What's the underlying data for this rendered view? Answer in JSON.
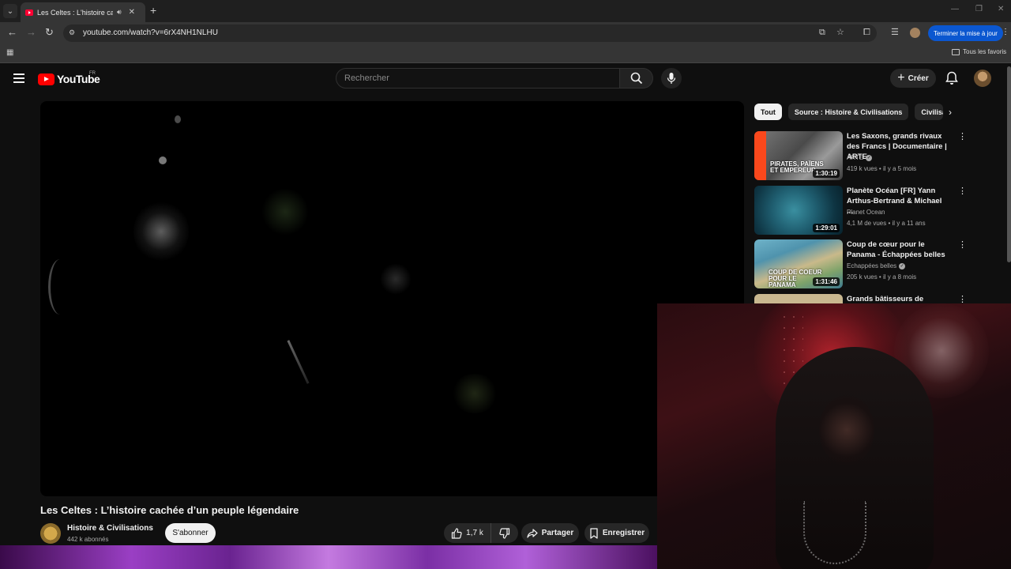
{
  "browser": {
    "tab_title": "Les Celtes : L'histoire cachée",
    "url": "youtube.com/watch?v=6rX4NH1NLHU",
    "update_button": "Terminer la mise à jour",
    "all_bookmarks": "Tous les favoris"
  },
  "youtube": {
    "logo_text": "YouTube",
    "country_code": "FR",
    "search_placeholder": "Rechercher",
    "create_label": "Créer"
  },
  "video": {
    "title": "Les Celtes : L’histoire cachée d’un peuple légendaire",
    "channel": "Histoire & Civilisations",
    "subscribers": "442 k abonnés",
    "subscribe_label": "S'abonner",
    "likes": "1,7 k",
    "share_label": "Partager",
    "save_label": "Enregistrer"
  },
  "chips": {
    "all": "Tout",
    "source": "Source : Histoire & Civilisations",
    "partial": "Civilisa"
  },
  "recommendations": [
    {
      "title": "Les Saxons, grands rivaux des Francs | Documentaire | ARTE",
      "channel": "ARTE",
      "verified": true,
      "meta": "419 k vues • il y a 5 mois",
      "duration": "1:30:19",
      "overlay": "PIRATES, PAÏENS ET EMPEREUR",
      "brand": "arte"
    },
    {
      "title": "Planète Océan [FR] Yann Arthus-Bertrand & Michael ...",
      "channel": "Planet Ocean",
      "verified": false,
      "meta": "4,1 M de vues • il y a 11 ans",
      "duration": "1:29:01"
    },
    {
      "title": "Coup de cœur pour le Panama - Échappées belles",
      "channel": "Echappées belles",
      "verified": true,
      "meta": "205 k vues • il y a 8 mois",
      "duration": "1:31:46",
      "overlay": "COUP DE COEUR POUR LE PANAMA"
    },
    {
      "title": "Grands bâtisseurs de France :"
    }
  ],
  "colors": {
    "bg": "#0f0f0f",
    "yt_red": "#ff0000",
    "update_blue": "#0b57d0",
    "arte_red": "#fa481c"
  }
}
